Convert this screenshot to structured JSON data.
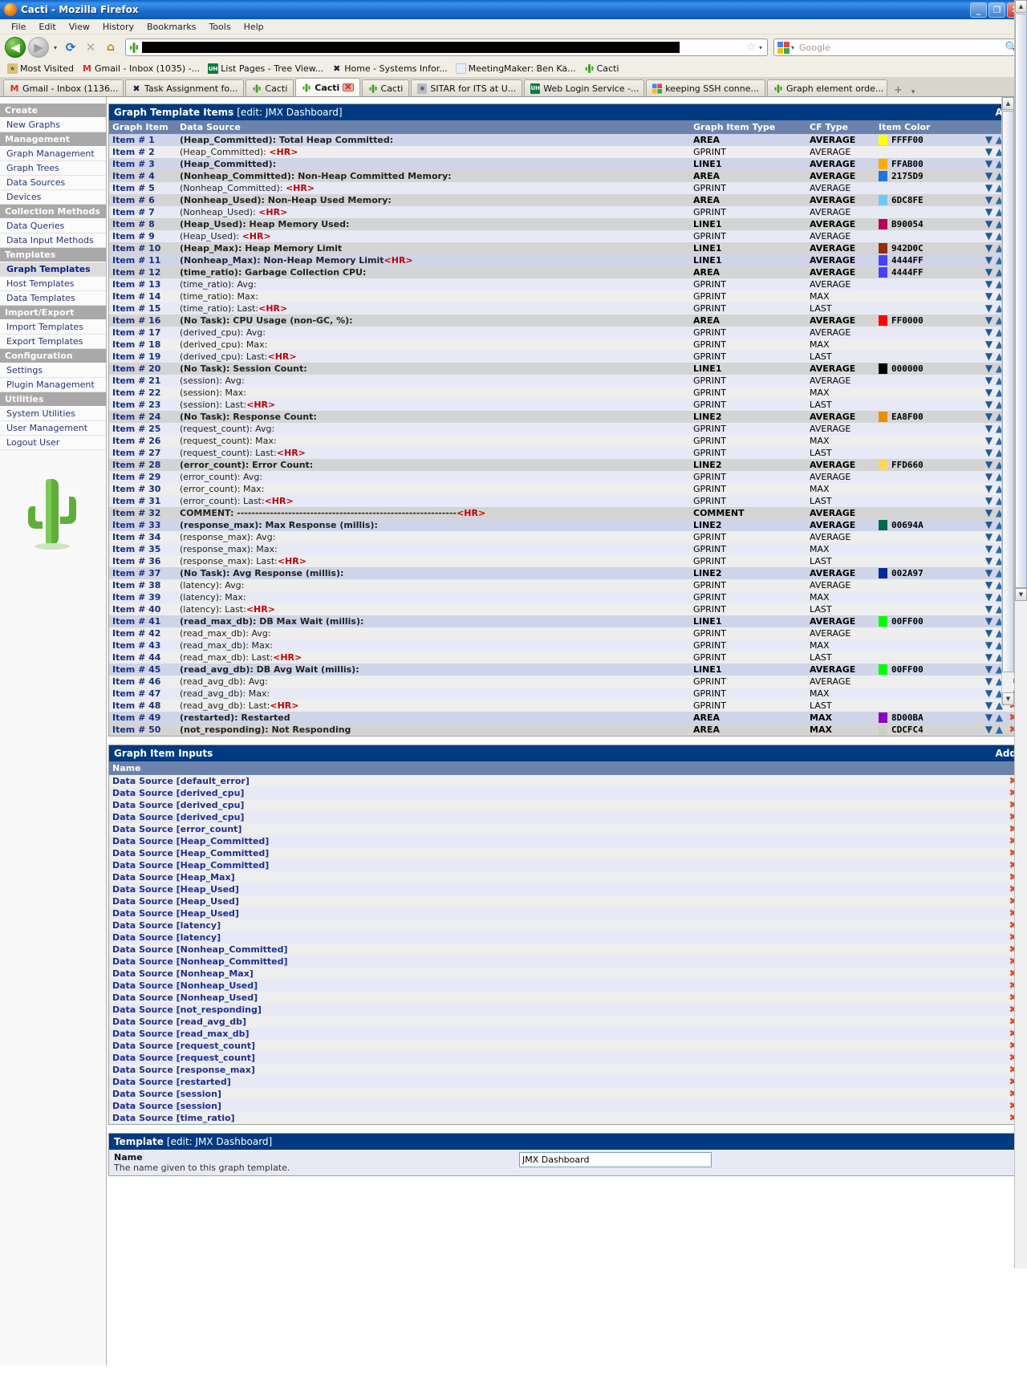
{
  "window": {
    "title": "Cacti - Mozilla Firefox",
    "icon": "firefox-icon",
    "minimize": "_",
    "maximize": "❐",
    "close": "✕"
  },
  "menubar": [
    "File",
    "Edit",
    "View",
    "History",
    "Bookmarks",
    "Tools",
    "Help"
  ],
  "toolbar": {
    "back": "◀",
    "forward": "▶",
    "dropdown": "▾",
    "reload": "⟳",
    "stop": "✕",
    "home": "⌂",
    "url_value": "",
    "star": "☆",
    "star_caret": "▾",
    "search_placeholder": "Google",
    "search_caret": "▾",
    "search_icon": "🔍"
  },
  "bookmarks": [
    {
      "label": "Most Visited",
      "icon": "folder-icon",
      "color": "#c8a23c",
      "glyph": "★"
    },
    {
      "label": "Gmail - Inbox (1035) -...",
      "icon": "gmail-icon",
      "color": "#d93025",
      "glyph": "M"
    },
    {
      "label": "List Pages - Tree View...",
      "icon": "uh-icon",
      "color": "#0c7c42",
      "glyph": "UH"
    },
    {
      "label": "Home - Systems Infor...",
      "icon": "x-icon",
      "color": "#ffffff",
      "glyph": "✖"
    },
    {
      "label": "MeetingMaker: Ben Ka...",
      "icon": "page-icon",
      "color": "#e8eef7",
      "glyph": ""
    },
    {
      "label": "Cacti",
      "icon": "cactus-icon",
      "color": "#3f9e22",
      "glyph": ""
    }
  ],
  "tabs": [
    {
      "label": "Gmail - Inbox (1136...",
      "icon": "gmail-icon",
      "color": "#d93025",
      "glyph": "M",
      "active": false,
      "closable": false
    },
    {
      "label": "Task Assignment fo...",
      "icon": "x-icon",
      "color": "#ffffff",
      "glyph": "✖",
      "active": false,
      "closable": false
    },
    {
      "label": "Cacti",
      "icon": "cactus-icon",
      "color": "#3f9e22",
      "glyph": "",
      "active": false,
      "closable": false
    },
    {
      "label": "Cacti",
      "icon": "cactus-icon",
      "color": "#3f9e22",
      "glyph": "",
      "active": true,
      "closable": true
    },
    {
      "label": "Cacti",
      "icon": "cactus-icon",
      "color": "#3f9e22",
      "glyph": "",
      "active": false,
      "closable": false
    },
    {
      "label": "SITAR for ITS at U...",
      "icon": "sitar-icon",
      "color": "#9aa0a6",
      "glyph": "",
      "active": false,
      "closable": false
    },
    {
      "label": "Web Login Service -...",
      "icon": "uh-icon",
      "color": "#0c7c42",
      "glyph": "UH",
      "active": false,
      "closable": false
    },
    {
      "label": "keeping SSH conne...",
      "icon": "google-icon",
      "color": "#ffffff",
      "glyph": "",
      "active": false,
      "closable": false
    },
    {
      "label": "Graph element orde...",
      "icon": "cactus-icon",
      "color": "#3f9e22",
      "glyph": "",
      "active": false,
      "closable": false
    }
  ],
  "tab_new": "+",
  "tab_list": "▾",
  "sidebar": [
    {
      "type": "head",
      "label": "Create"
    },
    {
      "type": "link",
      "label": "New Graphs",
      "current": false
    },
    {
      "type": "head",
      "label": "Management"
    },
    {
      "type": "link",
      "label": "Graph Management",
      "current": false
    },
    {
      "type": "link",
      "label": "Graph Trees",
      "current": false
    },
    {
      "type": "link",
      "label": "Data Sources",
      "current": false
    },
    {
      "type": "link",
      "label": "Devices",
      "current": false
    },
    {
      "type": "head",
      "label": "Collection Methods"
    },
    {
      "type": "link",
      "label": "Data Queries",
      "current": false
    },
    {
      "type": "link",
      "label": "Data Input Methods",
      "current": false
    },
    {
      "type": "head",
      "label": "Templates"
    },
    {
      "type": "link",
      "label": "Graph Templates",
      "current": true
    },
    {
      "type": "link",
      "label": "Host Templates",
      "current": false
    },
    {
      "type": "link",
      "label": "Data Templates",
      "current": false
    },
    {
      "type": "head",
      "label": "Import/Export"
    },
    {
      "type": "link",
      "label": "Import Templates",
      "current": false
    },
    {
      "type": "link",
      "label": "Export Templates",
      "current": false
    },
    {
      "type": "head",
      "label": "Configuration"
    },
    {
      "type": "link",
      "label": "Settings",
      "current": false
    },
    {
      "type": "link",
      "label": "Plugin Management",
      "current": false
    },
    {
      "type": "head",
      "label": "Utilities"
    },
    {
      "type": "link",
      "label": "System Utilities",
      "current": false
    },
    {
      "type": "link",
      "label": "User Management",
      "current": false
    },
    {
      "type": "link",
      "label": "Logout User",
      "current": false
    }
  ],
  "items_panel": {
    "title": "Graph Template Items",
    "subtitle": "[edit: JMX Dashboard]",
    "add_label": "Add",
    "columns": [
      "Graph Item",
      "Data Source",
      "Graph Item Type",
      "CF Type",
      "Item Color"
    ],
    "action_icons": {
      "move_down": "▼",
      "move_up": "▲",
      "delete": "✖"
    },
    "rows": [
      {
        "item": "Item # 1",
        "ds": "(Heap_Committed): Total Heap Committed:",
        "bold": true,
        "hr": false,
        "type": "AREA",
        "cf": "AVERAGE",
        "color": "FFFF00"
      },
      {
        "item": "Item # 2",
        "ds": "(Heap_Committed): ",
        "bold": false,
        "hr": true,
        "type": "GPRINT",
        "cf": "AVERAGE",
        "color": ""
      },
      {
        "item": "Item # 3",
        "ds": "(Heap_Committed):",
        "bold": true,
        "hr": false,
        "type": "LINE1",
        "cf": "AVERAGE",
        "color": "FFAB00"
      },
      {
        "item": "Item # 4",
        "ds": "(Nonheap_Committed): Non-Heap Committed Memory:",
        "bold": true,
        "hr": false,
        "type": "AREA",
        "cf": "AVERAGE",
        "color": "2175D9"
      },
      {
        "item": "Item # 5",
        "ds": "(Nonheap_Committed): ",
        "bold": false,
        "hr": true,
        "type": "GPRINT",
        "cf": "AVERAGE",
        "color": ""
      },
      {
        "item": "Item # 6",
        "ds": "(Nonheap_Used): Non-Heap Used Memory:",
        "bold": true,
        "hr": false,
        "type": "AREA",
        "cf": "AVERAGE",
        "color": "6DC8FE"
      },
      {
        "item": "Item # 7",
        "ds": "(Nonheap_Used): ",
        "bold": false,
        "hr": true,
        "type": "GPRINT",
        "cf": "AVERAGE",
        "color": ""
      },
      {
        "item": "Item # 8",
        "ds": "(Heap_Used): Heap Memory Used:",
        "bold": true,
        "hr": false,
        "type": "LINE1",
        "cf": "AVERAGE",
        "color": "B90054"
      },
      {
        "item": "Item # 9",
        "ds": "(Heap_Used): ",
        "bold": false,
        "hr": true,
        "type": "GPRINT",
        "cf": "AVERAGE",
        "color": ""
      },
      {
        "item": "Item # 10",
        "ds": "(Heap_Max): Heap Memory Limit",
        "bold": true,
        "hr": false,
        "type": "LINE1",
        "cf": "AVERAGE",
        "color": "942D0C"
      },
      {
        "item": "Item # 11",
        "ds": "(Nonheap_Max): Non-Heap Memory Limit",
        "bold": true,
        "hr": true,
        "type": "LINE1",
        "cf": "AVERAGE",
        "color": "4444FF"
      },
      {
        "item": "Item # 12",
        "ds": "(time_ratio): Garbage Collection CPU:",
        "bold": true,
        "hr": false,
        "type": "AREA",
        "cf": "AVERAGE",
        "color": "4444FF"
      },
      {
        "item": "Item # 13",
        "ds": "(time_ratio): Avg:",
        "bold": false,
        "hr": false,
        "type": "GPRINT",
        "cf": "AVERAGE",
        "color": ""
      },
      {
        "item": "Item # 14",
        "ds": "(time_ratio): Max:",
        "bold": false,
        "hr": false,
        "type": "GPRINT",
        "cf": "MAX",
        "color": ""
      },
      {
        "item": "Item # 15",
        "ds": "(time_ratio): Last:",
        "bold": false,
        "hr": true,
        "type": "GPRINT",
        "cf": "LAST",
        "color": ""
      },
      {
        "item": "Item # 16",
        "ds": "(No Task): CPU Usage (non-GC, %):",
        "bold": true,
        "hr": false,
        "type": "AREA",
        "cf": "AVERAGE",
        "color": "FF0000"
      },
      {
        "item": "Item # 17",
        "ds": "(derived_cpu): Avg:",
        "bold": false,
        "hr": false,
        "type": "GPRINT",
        "cf": "AVERAGE",
        "color": ""
      },
      {
        "item": "Item # 18",
        "ds": "(derived_cpu): Max:",
        "bold": false,
        "hr": false,
        "type": "GPRINT",
        "cf": "MAX",
        "color": ""
      },
      {
        "item": "Item # 19",
        "ds": "(derived_cpu): Last:",
        "bold": false,
        "hr": true,
        "type": "GPRINT",
        "cf": "LAST",
        "color": ""
      },
      {
        "item": "Item # 20",
        "ds": "(No Task): Session Count:",
        "bold": true,
        "hr": false,
        "type": "LINE1",
        "cf": "AVERAGE",
        "color": "000000"
      },
      {
        "item": "Item # 21",
        "ds": "(session): Avg:",
        "bold": false,
        "hr": false,
        "type": "GPRINT",
        "cf": "AVERAGE",
        "color": ""
      },
      {
        "item": "Item # 22",
        "ds": "(session): Max:",
        "bold": false,
        "hr": false,
        "type": "GPRINT",
        "cf": "MAX",
        "color": ""
      },
      {
        "item": "Item # 23",
        "ds": "(session): Last:",
        "bold": false,
        "hr": true,
        "type": "GPRINT",
        "cf": "LAST",
        "color": ""
      },
      {
        "item": "Item # 24",
        "ds": "(No Task): Response Count:",
        "bold": true,
        "hr": false,
        "type": "LINE2",
        "cf": "AVERAGE",
        "color": "EA8F00"
      },
      {
        "item": "Item # 25",
        "ds": "(request_count): Avg:",
        "bold": false,
        "hr": false,
        "type": "GPRINT",
        "cf": "AVERAGE",
        "color": ""
      },
      {
        "item": "Item # 26",
        "ds": "(request_count): Max:",
        "bold": false,
        "hr": false,
        "type": "GPRINT",
        "cf": "MAX",
        "color": ""
      },
      {
        "item": "Item # 27",
        "ds": "(request_count): Last:",
        "bold": false,
        "hr": true,
        "type": "GPRINT",
        "cf": "LAST",
        "color": ""
      },
      {
        "item": "Item # 28",
        "ds": "(error_count): Error Count:",
        "bold": true,
        "hr": false,
        "type": "LINE2",
        "cf": "AVERAGE",
        "color": "FFD660"
      },
      {
        "item": "Item # 29",
        "ds": "(error_count): Avg:",
        "bold": false,
        "hr": false,
        "type": "GPRINT",
        "cf": "AVERAGE",
        "color": ""
      },
      {
        "item": "Item # 30",
        "ds": "(error_count): Max:",
        "bold": false,
        "hr": false,
        "type": "GPRINT",
        "cf": "MAX",
        "color": ""
      },
      {
        "item": "Item # 31",
        "ds": "(error_count): Last:",
        "bold": false,
        "hr": true,
        "type": "GPRINT",
        "cf": "LAST",
        "color": ""
      },
      {
        "item": "Item # 32",
        "ds": "COMMENT: ------------------------------------------------------------",
        "bold": true,
        "hr": true,
        "type": "COMMENT",
        "cf": "AVERAGE",
        "color": ""
      },
      {
        "item": "Item # 33",
        "ds": "(response_max): Max Response (millis):",
        "bold": true,
        "hr": false,
        "type": "LINE2",
        "cf": "AVERAGE",
        "color": "00694A"
      },
      {
        "item": "Item # 34",
        "ds": "(response_max): Avg:",
        "bold": false,
        "hr": false,
        "type": "GPRINT",
        "cf": "AVERAGE",
        "color": ""
      },
      {
        "item": "Item # 35",
        "ds": "(response_max): Max:",
        "bold": false,
        "hr": false,
        "type": "GPRINT",
        "cf": "MAX",
        "color": ""
      },
      {
        "item": "Item # 36",
        "ds": "(response_max): Last:",
        "bold": false,
        "hr": true,
        "type": "GPRINT",
        "cf": "LAST",
        "color": ""
      },
      {
        "item": "Item # 37",
        "ds": "(No Task): Avg Response (millis):",
        "bold": true,
        "hr": false,
        "type": "LINE2",
        "cf": "AVERAGE",
        "color": "002A97"
      },
      {
        "item": "Item # 38",
        "ds": "(latency): Avg:",
        "bold": false,
        "hr": false,
        "type": "GPRINT",
        "cf": "AVERAGE",
        "color": ""
      },
      {
        "item": "Item # 39",
        "ds": "(latency): Max:",
        "bold": false,
        "hr": false,
        "type": "GPRINT",
        "cf": "MAX",
        "color": ""
      },
      {
        "item": "Item # 40",
        "ds": "(latency): Last:",
        "bold": false,
        "hr": true,
        "type": "GPRINT",
        "cf": "LAST",
        "color": ""
      },
      {
        "item": "Item # 41",
        "ds": "(read_max_db): DB Max Wait (millis):",
        "bold": true,
        "hr": false,
        "type": "LINE1",
        "cf": "AVERAGE",
        "color": "00FF00"
      },
      {
        "item": "Item # 42",
        "ds": "(read_max_db): Avg:",
        "bold": false,
        "hr": false,
        "type": "GPRINT",
        "cf": "AVERAGE",
        "color": ""
      },
      {
        "item": "Item # 43",
        "ds": "(read_max_db): Max:",
        "bold": false,
        "hr": false,
        "type": "GPRINT",
        "cf": "MAX",
        "color": ""
      },
      {
        "item": "Item # 44",
        "ds": "(read_max_db): Last:",
        "bold": false,
        "hr": true,
        "type": "GPRINT",
        "cf": "LAST",
        "color": ""
      },
      {
        "item": "Item # 45",
        "ds": "(read_avg_db): DB Avg Wait (millis):",
        "bold": true,
        "hr": false,
        "type": "LINE1",
        "cf": "AVERAGE",
        "color": "00FF00"
      },
      {
        "item": "Item # 46",
        "ds": "(read_avg_db): Avg:",
        "bold": false,
        "hr": false,
        "type": "GPRINT",
        "cf": "AVERAGE",
        "color": ""
      },
      {
        "item": "Item # 47",
        "ds": "(read_avg_db): Max:",
        "bold": false,
        "hr": false,
        "type": "GPRINT",
        "cf": "MAX",
        "color": ""
      },
      {
        "item": "Item # 48",
        "ds": "(read_avg_db): Last:",
        "bold": false,
        "hr": true,
        "type": "GPRINT",
        "cf": "LAST",
        "color": ""
      },
      {
        "item": "Item # 49",
        "ds": "(restarted): Restarted",
        "bold": true,
        "hr": false,
        "type": "AREA",
        "cf": "MAX",
        "color": "8D00BA"
      },
      {
        "item": "Item # 50",
        "ds": "(not_responding): Not Responding",
        "bold": true,
        "hr": false,
        "type": "AREA",
        "cf": "MAX",
        "color": "CDCFC4"
      }
    ]
  },
  "inputs_panel": {
    "title": "Graph Item Inputs",
    "add_label": "Add",
    "column": "Name",
    "delete_icon": "✖",
    "rows": [
      "Data Source [default_error]",
      "Data Source [derived_cpu]",
      "Data Source [derived_cpu]",
      "Data Source [derived_cpu]",
      "Data Source [error_count]",
      "Data Source [Heap_Committed]",
      "Data Source [Heap_Committed]",
      "Data Source [Heap_Committed]",
      "Data Source [Heap_Max]",
      "Data Source [Heap_Used]",
      "Data Source [Heap_Used]",
      "Data Source [Heap_Used]",
      "Data Source [latency]",
      "Data Source [latency]",
      "Data Source [Nonheap_Committed]",
      "Data Source [Nonheap_Committed]",
      "Data Source [Nonheap_Max]",
      "Data Source [Nonheap_Used]",
      "Data Source [Nonheap_Used]",
      "Data Source [not_responding]",
      "Data Source [read_avg_db]",
      "Data Source [read_max_db]",
      "Data Source [request_count]",
      "Data Source [request_count]",
      "Data Source [response_max]",
      "Data Source [restarted]",
      "Data Source [session]",
      "Data Source [session]",
      "Data Source [time_ratio]"
    ]
  },
  "template_panel": {
    "title": "Template",
    "subtitle": "[edit: JMX Dashboard]",
    "field_name": "Name",
    "field_desc": "The name given to this graph template.",
    "field_value": "JMX Dashboard"
  },
  "scrollbars": {
    "up": "▲",
    "down": "▼"
  }
}
